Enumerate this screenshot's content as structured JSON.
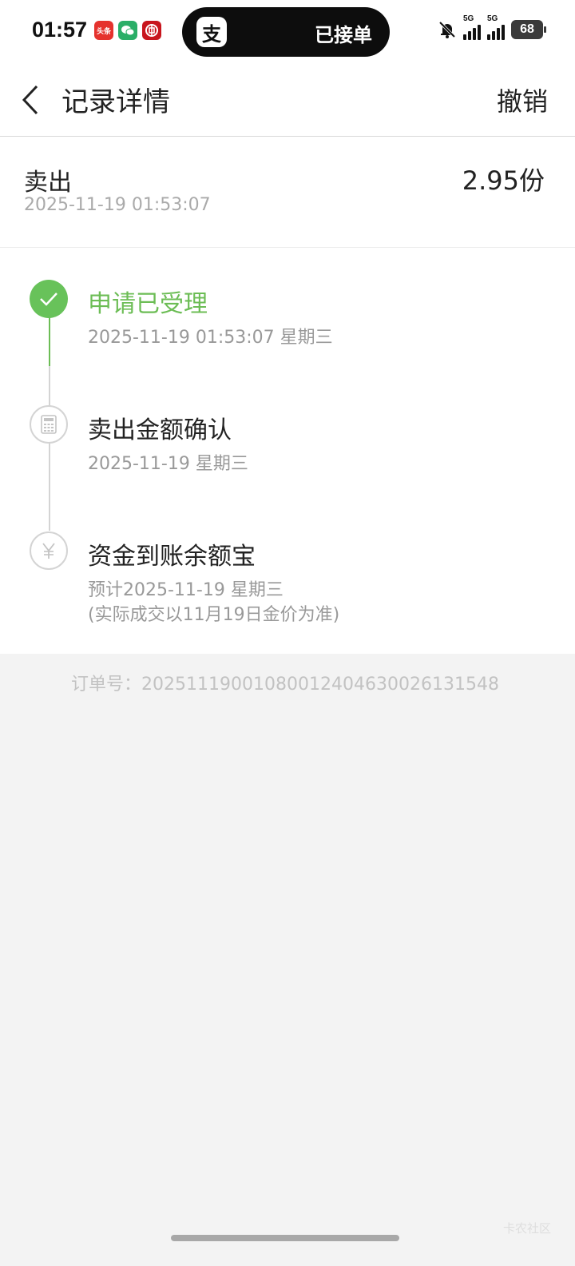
{
  "status_bar": {
    "time": "01:57",
    "app_icons": [
      {
        "name": "news-app-icon",
        "glyph": "头条",
        "color": "#e5322d"
      },
      {
        "name": "wechat-icon",
        "glyph": "✉",
        "color": "#2aae67"
      },
      {
        "name": "bank-app-icon",
        "glyph": "◎",
        "color": "#c8151d"
      }
    ],
    "island": {
      "app_glyph": "支",
      "text": "已接单"
    },
    "network": [
      "5G",
      "5G"
    ],
    "battery": "68"
  },
  "nav": {
    "title": "记录详情",
    "undo_label": "撤销"
  },
  "summary": {
    "type": "卖出",
    "time": "2025-11-19 01:53:07",
    "amount": "2.95份"
  },
  "timeline": {
    "accent": "#6cbd55",
    "steps": [
      {
        "title": "申请已受理",
        "sub": "2025-11-19 01:53:07 星期三",
        "status": "done"
      },
      {
        "title": "卖出金额确认",
        "sub": "2025-11-19 星期三",
        "status": "pending"
      },
      {
        "title": "资金到账余额宝",
        "sub": "预计2025-11-19 星期三",
        "sub2": "(实际成交以11月19日金价为准)",
        "status": "pending"
      }
    ]
  },
  "order": {
    "label": "订单号：",
    "number": "2025111900108001240463002613154​8"
  },
  "watermark": "卡农社区"
}
